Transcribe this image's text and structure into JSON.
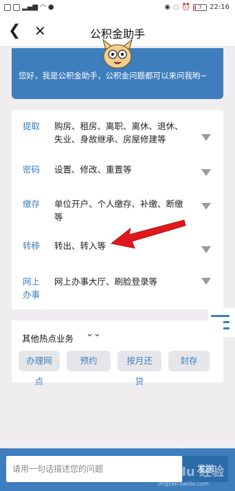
{
  "status_bar": {
    "time": "22:16",
    "battery": "7"
  },
  "header": {
    "title": "公积金助手"
  },
  "banner": {
    "greeting": "您好，我是公积金助手，公积金问题都可以来问我哟~"
  },
  "topics": [
    {
      "label": "提取",
      "desc": "购房、租房、离职、离休、退休、失业、身故继承、房屋修建等"
    },
    {
      "label": "密码",
      "desc": "设置、修改、重置等"
    },
    {
      "label": "缴存",
      "desc": "单位开户、个人缴存、补缴、断缴等"
    },
    {
      "label": "转移",
      "desc": "转出、转入等"
    },
    {
      "label": "网上办事",
      "desc": "网上办事大厅、刷脸登录等"
    }
  ],
  "hot_services": {
    "heading": "其他热点业务",
    "chips": [
      "办理网点",
      "预约",
      "按月还贷",
      "封存"
    ]
  },
  "input": {
    "placeholder": "请用一句话描述您的问题",
    "send_label": "发送"
  },
  "watermark": {
    "text": "Baidu 经验",
    "sub": "jingyan.baidu.com"
  },
  "colors": {
    "accent": "#3e7ebd",
    "annotation": "#e0181a"
  }
}
